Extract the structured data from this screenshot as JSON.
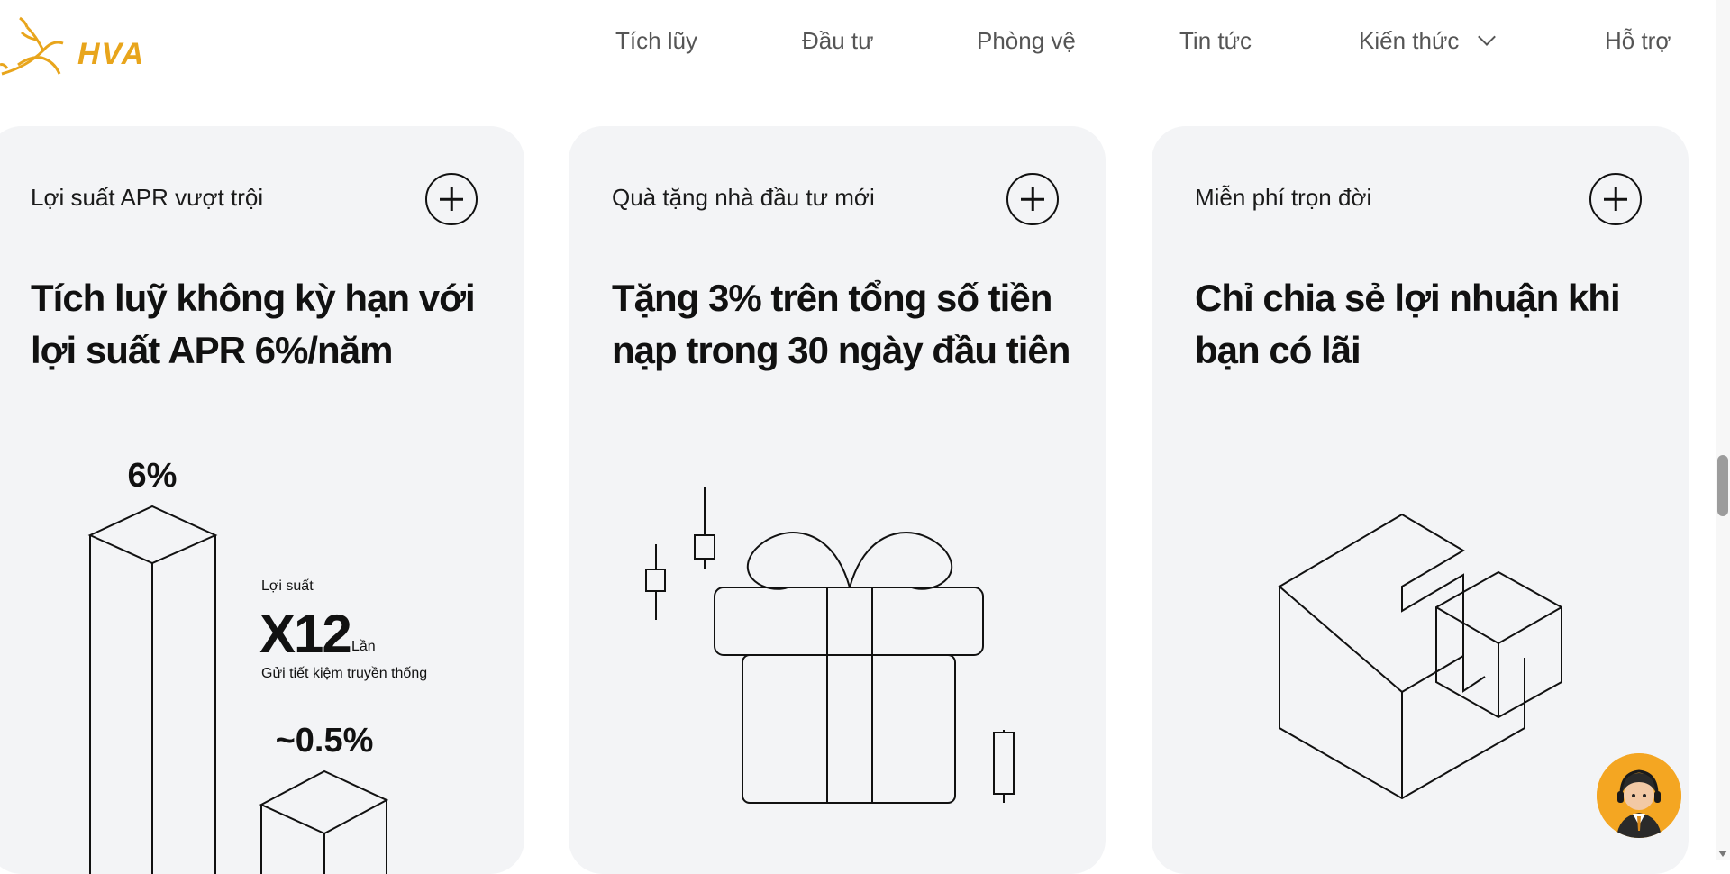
{
  "brand": {
    "name": "HVA",
    "color": "#e8a51c"
  },
  "nav": {
    "items": [
      {
        "label": "Tích lũy"
      },
      {
        "label": "Đầu tư"
      },
      {
        "label": "Phòng vệ"
      },
      {
        "label": "Tin tức"
      },
      {
        "label": "Kiến thức",
        "icon": "chevron-down-icon"
      },
      {
        "label": "Hỗ trợ"
      }
    ]
  },
  "cards": [
    {
      "subtitle": "Lợi suất APR vượt trội",
      "title_line1": "Tích luỹ không kỳ hạn với",
      "title_line2": "lợi suất APR 6%/năm",
      "icon": "plus-icon",
      "illustration": {
        "big_bar_label": "6%",
        "small_bar_label": "~0.5%",
        "caption_top": "Lợi suất",
        "multiplier": "X12",
        "multiplier_unit": "Lần",
        "caption_bottom": "Gửi tiết kiệm truyền thống"
      }
    },
    {
      "subtitle": "Quà tặng nhà đầu tư mới",
      "title_line1": "Tặng 3% trên tổng số tiền",
      "title_line2": "nạp trong 30 ngày đầu tiên",
      "icon": "plus-icon",
      "illustration": {
        "icon": "gift-icon"
      }
    },
    {
      "subtitle": "Miễn phí trọn đời",
      "title_line1": "Chỉ chia sẻ lợi nhuận khi",
      "title_line2": "bạn có lãi",
      "icon": "plus-icon",
      "illustration": {
        "icon": "box-icon"
      }
    }
  ],
  "chat": {
    "icon": "support-avatar-icon",
    "color": "#f4a622"
  }
}
